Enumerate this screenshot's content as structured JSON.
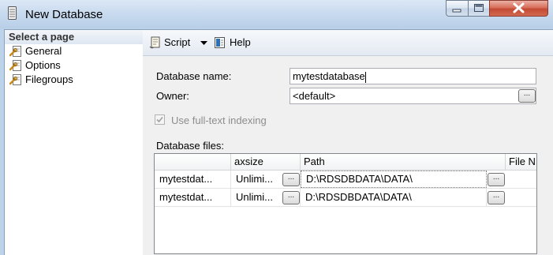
{
  "window": {
    "title": "New Database"
  },
  "sidebar": {
    "header": "Select a page",
    "items": [
      {
        "label": "General",
        "icon": "page-wrench-icon"
      },
      {
        "label": "Options",
        "icon": "page-wrench-icon"
      },
      {
        "label": "Filegroups",
        "icon": "page-wrench-icon"
      }
    ]
  },
  "toolbar": {
    "script_label": "Script",
    "help_label": "Help"
  },
  "form": {
    "database_name_label": "Database name:",
    "database_name_value": "mytestdatabase",
    "owner_label": "Owner:",
    "owner_value": "<default>",
    "fulltext_label": "Use full-text indexing",
    "fulltext_checked": true,
    "database_files_label": "Database files:"
  },
  "files_grid": {
    "columns": [
      "",
      "axsize",
      "",
      "Path",
      "",
      "File N"
    ],
    "rows": [
      {
        "logical_name": "mytestdat...",
        "maxsize": "Unlimi...",
        "button": "...",
        "path": "D:\\RDSDBDATA\\DATA\\",
        "path_button": "..."
      },
      {
        "logical_name": "mytestdat...",
        "maxsize": "Unlimi...",
        "button": "...",
        "path": "D:\\RDSDBDATA\\DATA\\",
        "path_button": "..."
      }
    ]
  },
  "colors": {
    "title_bar": "#c6d9ee",
    "close_button": "#c24a34",
    "panel_background": "#f0f0f0"
  }
}
